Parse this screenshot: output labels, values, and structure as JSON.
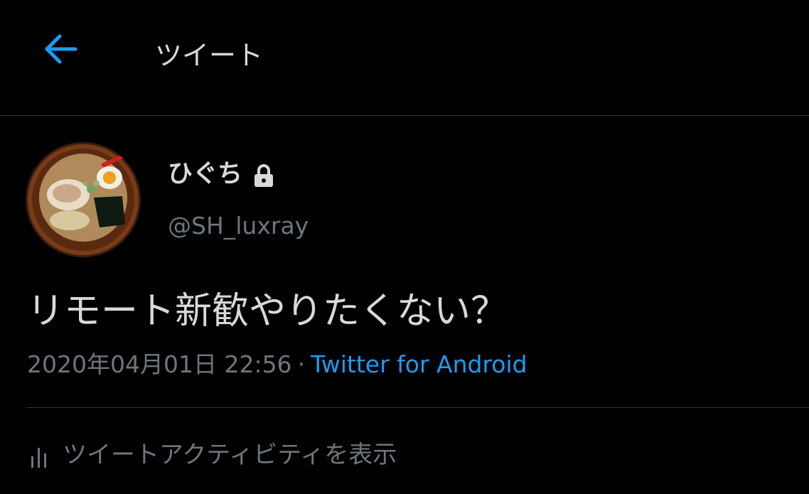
{
  "header": {
    "title": "ツイート",
    "back_icon": "arrow-left-icon",
    "accent_color": "#1d9bf0"
  },
  "tweet": {
    "author": {
      "display_name": "ひぐち",
      "handle": "@SH_luxray",
      "protected_icon": "lock-icon",
      "avatar": "ramen-bowl-photo"
    },
    "text": "リモート新歓やりたくない？",
    "timestamp": "2020年04月01日 22:56",
    "separator": "·",
    "source": "Twitter for Android"
  },
  "activity": {
    "icon": "bar-chart-icon",
    "label": "ツイートアクティビティを表示"
  }
}
